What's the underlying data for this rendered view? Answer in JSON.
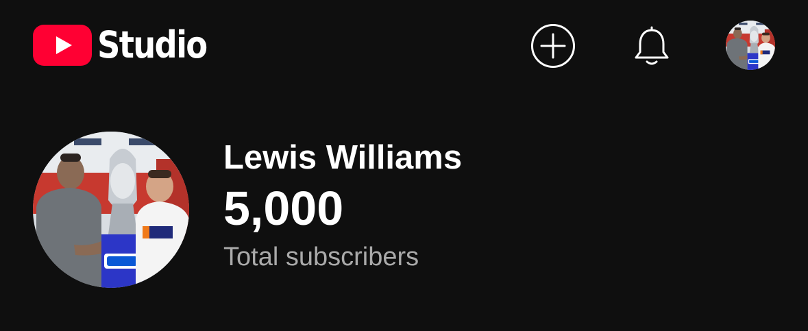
{
  "header": {
    "logo_text": "Studio",
    "logo_icon": "youtube-play-icon",
    "actions": [
      {
        "name": "create",
        "icon": "plus-circle-icon"
      },
      {
        "name": "notifications",
        "icon": "bell-icon"
      },
      {
        "name": "account",
        "icon": "avatar"
      }
    ]
  },
  "channel": {
    "name": "Lewis Williams",
    "subscriber_count": "5,000",
    "subscriber_label": "Total subscribers"
  },
  "colors": {
    "background": "#0f0f0f",
    "brand_red": "#ff0033",
    "text_primary": "#ffffff",
    "text_secondary": "#aaaaaa"
  }
}
